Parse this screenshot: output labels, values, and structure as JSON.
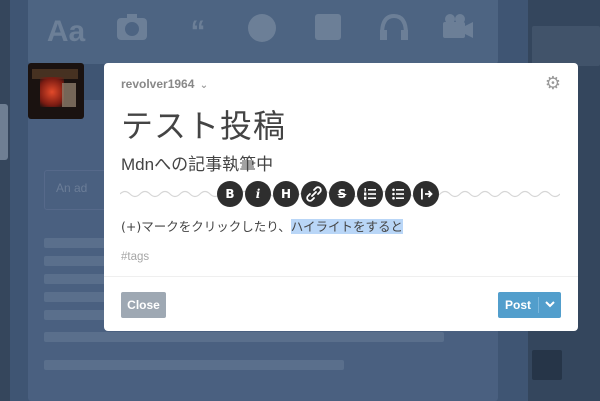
{
  "background": {
    "post_bar_icons": [
      "Aa",
      "camera-icon",
      "quote-icon",
      "link-icon",
      "chat-icon",
      "audio-icon",
      "video-icon"
    ],
    "quote_snippet": "An ad"
  },
  "modal": {
    "blog_name": "revolver1964",
    "title": "テスト投稿",
    "subtitle": "Mdnへの記事執筆中",
    "body_plain": "(+)マークをクリックしたり、",
    "body_highlight": "ハイライトをすると",
    "tags_placeholder": "#tags",
    "format_buttons": [
      "B",
      "i",
      "H",
      "link",
      "S",
      "ordered-list",
      "bulleted-list",
      "read-more"
    ],
    "close_label": "Close",
    "post_label": "Post"
  },
  "colors": {
    "post_button": "#529ecc",
    "close_button": "#9ea8b3",
    "highlight": "#b9d6f7",
    "background": "#3f5573"
  }
}
